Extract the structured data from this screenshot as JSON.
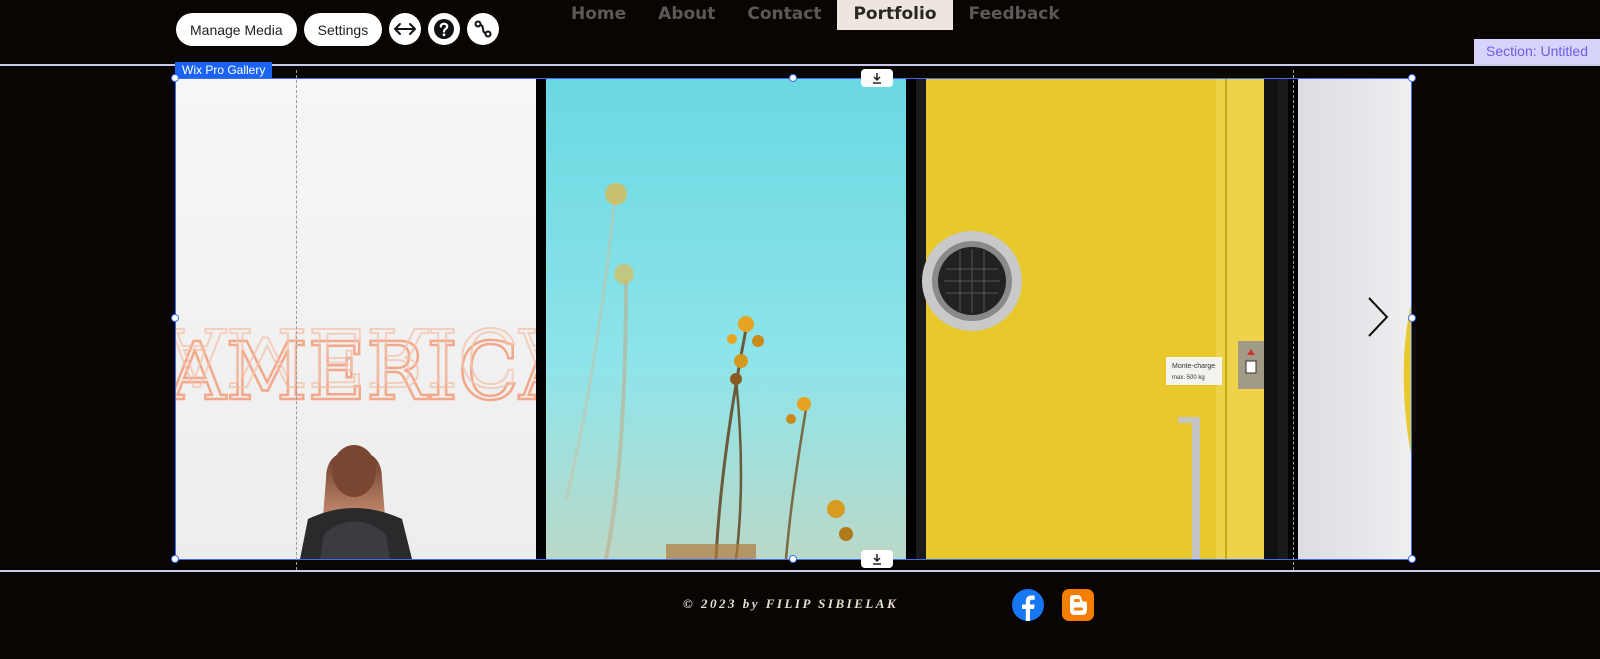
{
  "nav": {
    "items": [
      "Home",
      "About",
      "Contact",
      "Portfolio",
      "Feedback"
    ],
    "active": "Portfolio"
  },
  "toolbar": {
    "manage_media_label": "Manage Media",
    "settings_label": "Settings",
    "icons": [
      "stretch-icon",
      "help-icon",
      "connect-icon"
    ]
  },
  "section_badge": "Section: Untitled",
  "gallery": {
    "tag": "Wix Pro Gallery",
    "images": [
      {
        "name": "neon-america-sign-photo",
        "neon_text": "AMERICA"
      },
      {
        "name": "yellow-flowers-sky-photo"
      },
      {
        "name": "yellow-elevator-door-photo",
        "sign_line1": "Monte-charge",
        "sign_line2": "max. 500 kg"
      },
      {
        "name": "partial-yellow-wall-photo"
      }
    ],
    "icons": [
      "download-icon",
      "chevron-right-icon"
    ]
  },
  "footer": {
    "copyright": "© 2023 by FILIP SIBIELAK",
    "social": [
      "facebook-icon",
      "blogger-icon"
    ]
  },
  "colors": {
    "background": "#080503",
    "selection_blue": "#3f6df0",
    "section_badge_bg": "#d7d4fb",
    "nav_active_bg": "#ece6de",
    "facebook_blue": "#1877f2",
    "blogger_orange": "#f57d00"
  }
}
